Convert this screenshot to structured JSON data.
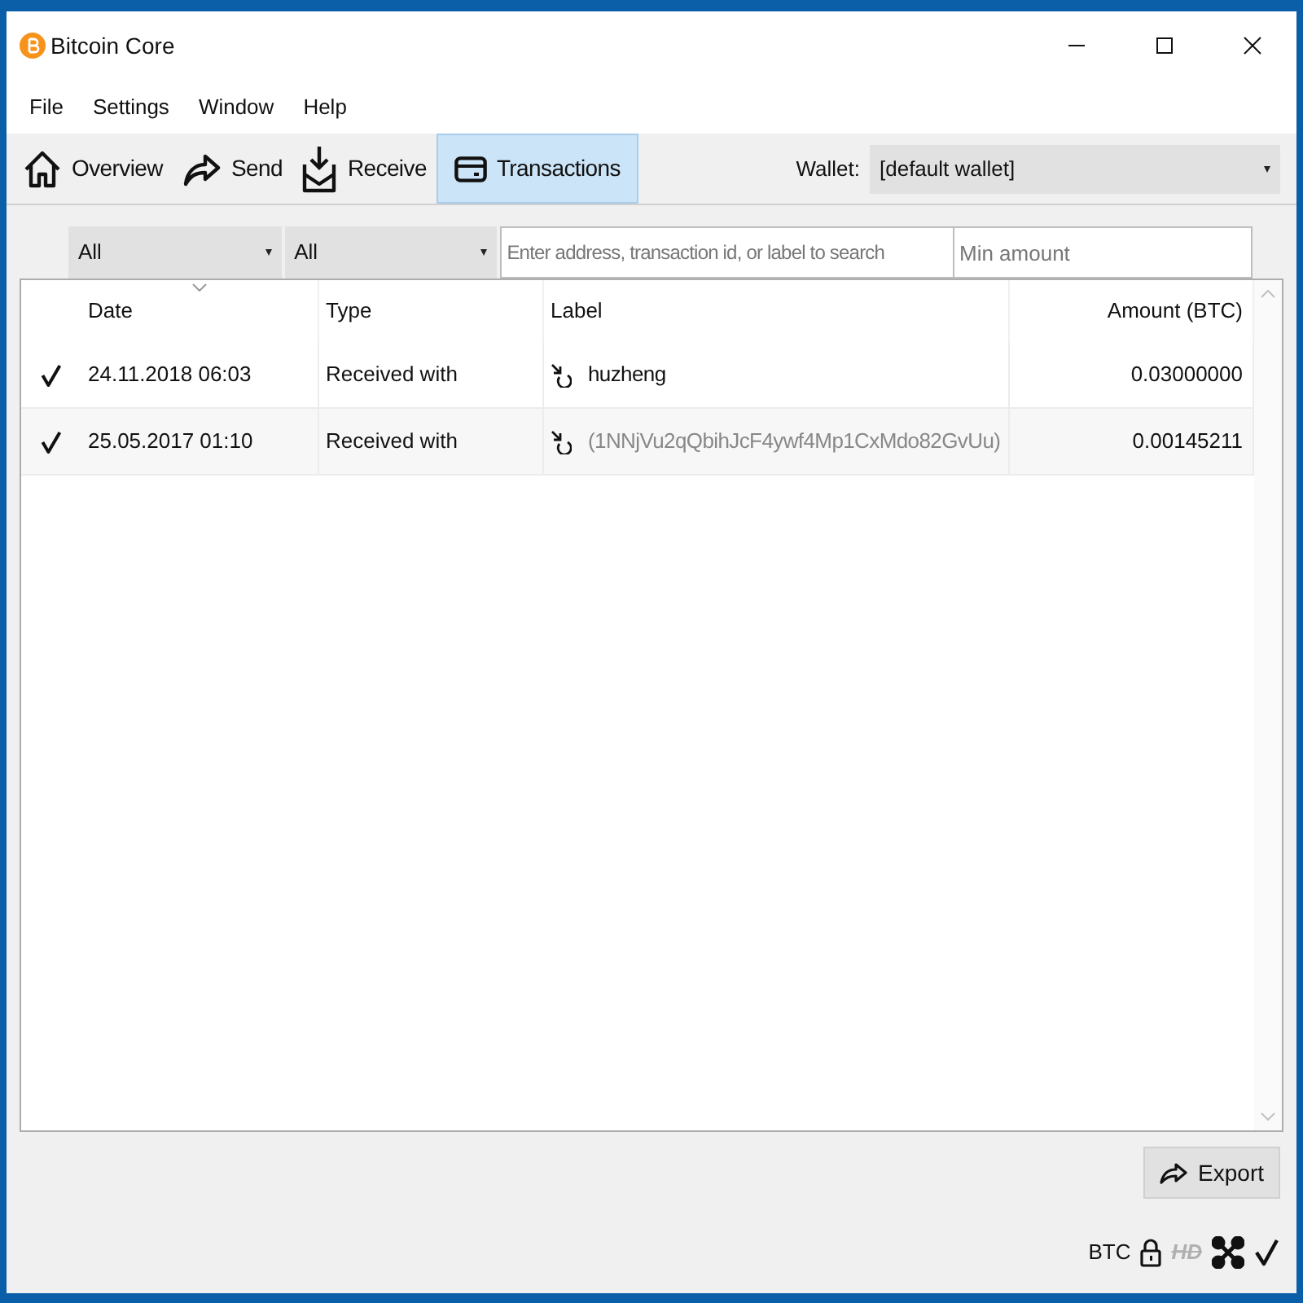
{
  "window": {
    "title": "Bitcoin Core"
  },
  "menu": [
    "File",
    "Settings",
    "Window",
    "Help"
  ],
  "tabs": [
    {
      "label": "Overview",
      "selected": false
    },
    {
      "label": "Send",
      "selected": false
    },
    {
      "label": "Receive",
      "selected": false
    },
    {
      "label": "Transactions",
      "selected": true
    }
  ],
  "wallet": {
    "label": "Wallet:",
    "value": "[default wallet]"
  },
  "filters": {
    "date": "All",
    "type": "All",
    "search_placeholder": "Enter address, transaction id, or label to search",
    "amount_placeholder": "Min amount"
  },
  "table": {
    "columns": [
      "Date",
      "Type",
      "Label",
      "Amount (BTC)"
    ],
    "rows": [
      {
        "confirmed": true,
        "date": "24.11.2018 06:03",
        "type": "Received with",
        "label": "huzheng",
        "kind": "label",
        "amount": "0.03000000"
      },
      {
        "confirmed": true,
        "date": "25.05.2017 01:10",
        "type": "Received with",
        "label": "(1NNjVu2qQbihJcF4ywf4Mp1CxMdo82GvUu)",
        "kind": "address",
        "amount": "0.00145211"
      }
    ]
  },
  "export_button": "Export",
  "status_bar": {
    "unit": "BTC",
    "hd": {
      "label": "HD",
      "enabled": false
    }
  }
}
